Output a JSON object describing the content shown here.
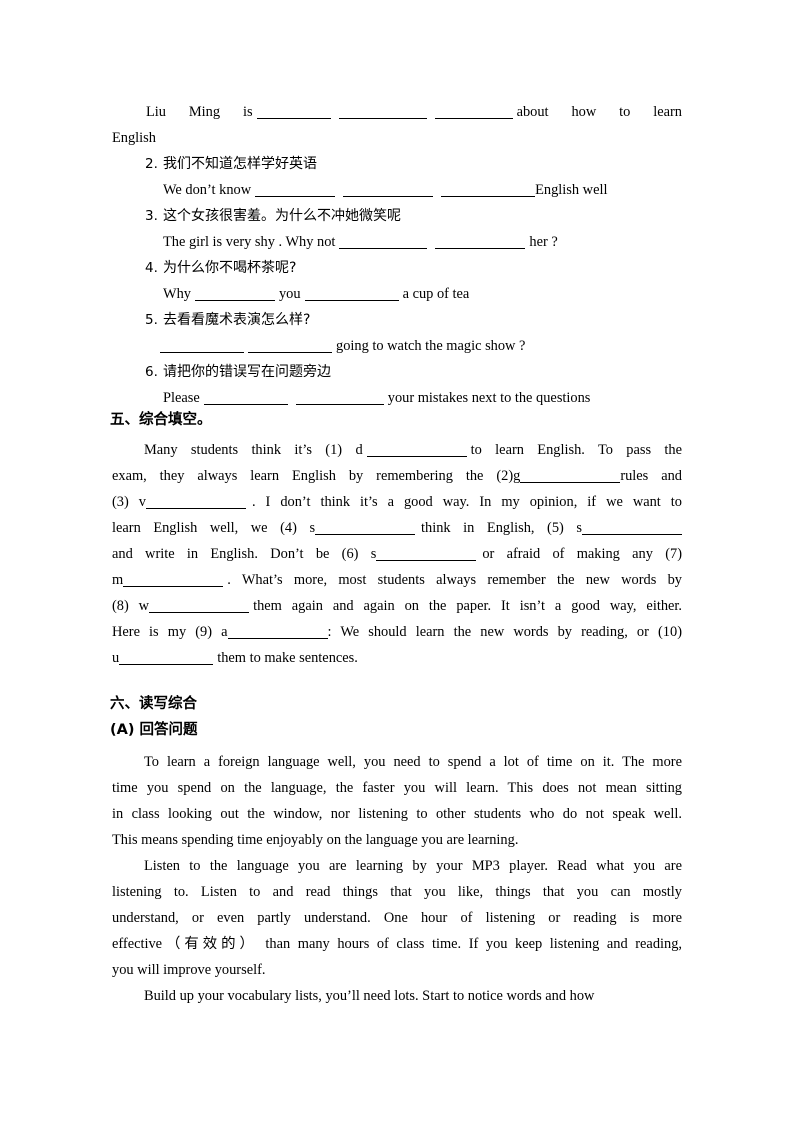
{
  "document": {
    "language_mix": "Chinese-English English exam worksheet",
    "page_background": "#ffffff",
    "text_color": "#000000"
  },
  "translation_section": {
    "item1_continuation": {
      "en_line": "Liu  Ming  is",
      "blanks": 3,
      "en_tail": "about  how  to  learn",
      "wrap_line": "English"
    },
    "items": [
      {
        "number": "2.",
        "cn": "我们不知道怎样学好英语",
        "en_prefix": "We don’t know",
        "blanks": 3,
        "en_suffix": "English well"
      },
      {
        "number": "3.",
        "cn": "这个女孩很害羞。为什么不冲她微笑呢",
        "en_prefix": "The girl is very shy . Why not",
        "blanks": 2,
        "en_suffix": "her ?"
      },
      {
        "number": "4.",
        "cn": "为什么你不喝杯茶呢?",
        "en_prefix": "Why",
        "en_middle": "you",
        "blanks": 2,
        "en_suffix": "a cup of tea"
      },
      {
        "number": "5.",
        "cn": "去看看魔术表演怎么样?",
        "en_prefix": "",
        "blanks": 2,
        "en_suffix": "going to watch the magic show ?"
      },
      {
        "number": "6.",
        "cn": "请把你的错误写在问题旁边",
        "en_prefix": "Please",
        "blanks": 2,
        "en_suffix": "your mistakes next to the questions"
      }
    ]
  },
  "section_five": {
    "heading": "五、综合填空。",
    "lines": [
      {
        "segments": [
          "Many  students  think  it’s  (1)  d",
          "BLANK",
          "to  learn  English.  To  pass  the"
        ]
      },
      {
        "segments": [
          "exam, they always learn English by remembering the (2)g",
          "BLANK",
          "rules and"
        ]
      },
      {
        "segments": [
          "(3) v",
          "BLANK",
          ". I don’t think it’s a good way. In my opinion, if we want to"
        ]
      },
      {
        "segments": [
          "learn English well, we (4) s",
          "BLANK",
          "think in English, (5) s",
          "BLANK"
        ]
      },
      {
        "segments": [
          "and  write  in  English.  Don’t  be  (6)  s",
          "BLANK",
          "or  afraid  of  making  any  (7)"
        ]
      },
      {
        "segments": [
          "m",
          "BLANK",
          ". What’s more, most students always remember the new words by"
        ]
      },
      {
        "segments": [
          "(8) w",
          "BLANK",
          "them again and again on the paper. It isn’t a good way, either."
        ]
      },
      {
        "segments": [
          "Here is my (9) a",
          "BLANK",
          ": We should learn the new words by reading, or (10)"
        ]
      },
      {
        "segments": [
          "u",
          "BLANK",
          "them to make sentences."
        ]
      }
    ],
    "full_text": "Many students think it’s (1) d________ to learn English. To pass the exam, they always learn English by remembering the (2)g________rules and (3) v________ . I don’t think it’s a good way. In my opinion, if we want to learn English well, we (4) s________ think in English, (5) s________ and write in English. Don’t be (6) s________ or afraid of making any (7) m________ . What’s more, most students always remember the new words by (8) w________ them again and again on the paper. It isn’t a good way, either. Here is my (9) a________: We should learn the new words by reading, or (10) u________ them to make sentences."
  },
  "section_six": {
    "heading": "六、读写综合",
    "subheading": "(A) 回答问题",
    "paragraphs": [
      "To learn a foreign language well, you need to spend a lot of time on it. The more time you spend on the language, the faster you will learn. This does not mean sitting in class looking out the window, nor listening to other students who do not speak well. This means spending time enjoyably on the language you are learning.",
      "Listen to the language you are learning by your MP3 player. Read what you are listening to. Listen to and read things that you like, things that you can mostly understand, or even partly understand. One hour of listening or reading is more effective（有效的） than many hours of class time. If you keep listening and reading, you will improve yourself.",
      "Build up your vocabulary lists, you’ll need lots. Start to notice words and how"
    ],
    "paragraph_lines": [
      "To learn a foreign language well, you need to spend a lot of time on it. The more",
      "time you spend on the language, the faster you will learn. This does not mean sitting",
      "in class looking out the window, nor listening to other students who do not speak well.",
      "This means spending time enjoyably on the language you are learning.",
      "Listen to the language you are learning by your MP3 player. Read what you are",
      "listening to. Listen to and read things that you like, things that you can mostly",
      "understand, or even partly understand. One hour of listening or reading is more",
      "effective（有效的） than many hours of class time. If you keep listening and reading,",
      "you will improve yourself.",
      "Build up your vocabulary lists, you’ll need lots. Start to notice words and how"
    ]
  }
}
